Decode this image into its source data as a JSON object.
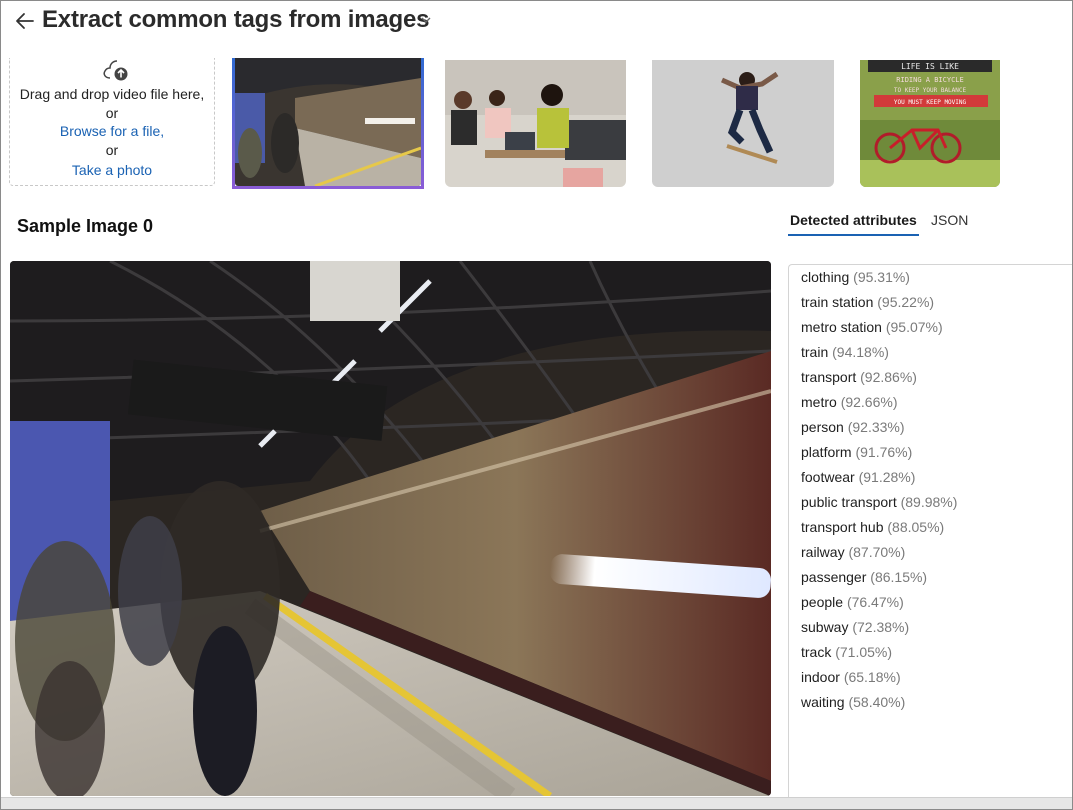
{
  "header": {
    "title": "Extract common tags from images"
  },
  "upload": {
    "line1": "Drag and drop video file here,",
    "line2": "or",
    "browse_link": "Browse for a file,",
    "line4": "or",
    "photo_link": "Take a photo"
  },
  "sample": {
    "title": "Sample Image 0"
  },
  "tabs": [
    {
      "label": "Detected attributes",
      "selected": true
    },
    {
      "label": "JSON",
      "selected": false
    }
  ],
  "attributes": [
    {
      "name": "clothing",
      "score": "(95.31%)"
    },
    {
      "name": "train station",
      "score": "(95.22%)"
    },
    {
      "name": "metro station",
      "score": "(95.07%)"
    },
    {
      "name": "train",
      "score": "(94.18%)"
    },
    {
      "name": "transport",
      "score": "(92.86%)"
    },
    {
      "name": "metro",
      "score": "(92.66%)"
    },
    {
      "name": "person",
      "score": "(92.33%)"
    },
    {
      "name": "platform",
      "score": "(91.76%)"
    },
    {
      "name": "footwear",
      "score": "(91.28%)"
    },
    {
      "name": "public transport",
      "score": "(89.98%)"
    },
    {
      "name": "transport hub",
      "score": "(88.05%)"
    },
    {
      "name": "railway",
      "score": "(87.70%)"
    },
    {
      "name": "passenger",
      "score": "(86.15%)"
    },
    {
      "name": "people",
      "score": "(76.47%)"
    },
    {
      "name": "subway",
      "score": "(72.38%)"
    },
    {
      "name": "track",
      "score": "(71.05%)"
    },
    {
      "name": "indoor",
      "score": "(65.18%)"
    },
    {
      "name": "waiting",
      "score": "(58.40%)"
    }
  ],
  "thumbnail_poster_lines": [
    "LIFE IS LIKE",
    "RIDING A BICYCLE",
    "TO KEEP YOUR BALANCE",
    "YOU MUST KEEP MOVING"
  ],
  "icons": {
    "back": "arrow-left-icon",
    "title_menu": "chevron-down-icon",
    "upload": "cloud-upload-icon"
  },
  "colors": {
    "accent": "#1a62b3",
    "link": "#1a62b3",
    "score": "#7a7a7a"
  }
}
